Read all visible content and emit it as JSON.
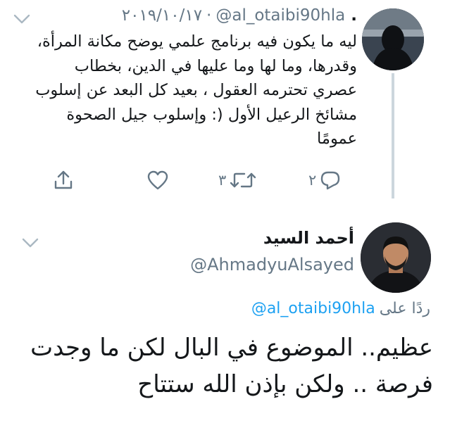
{
  "parent_tweet": {
    "dot": ".",
    "handle": "@al_otaibi90hla",
    "separator": "·",
    "date": "٢٠١٩/١٠/١٧",
    "text": "ليه ما يكون فيه برنامج علمي يوضح مكانة المرأة، وقدرها، وما لها وما عليها في الدين، بخطاب عصري تحترمه العقول ، بعيد كل البعد عن إسلوب مشائخ الرعيل الأول (: وإسلوب جيل الصحوة عمومًا",
    "actions": {
      "reply_count": "٢",
      "retweet_count": "٣"
    }
  },
  "reply_tweet": {
    "name": "أحمد السيد",
    "handle": "@AhmadyuAlsayed",
    "reply_prefix": "ردًا على",
    "reply_to_handle": "@al_otaibi90hla",
    "text": "عظيم.. الموضوع في البال لكن ما وجدت فرصة .. ولكن بإذن الله ستتاح"
  },
  "colors": {
    "text": "#14171a",
    "muted": "#657786",
    "link": "#1da1f2",
    "thread_line": "#ccd6dd"
  }
}
